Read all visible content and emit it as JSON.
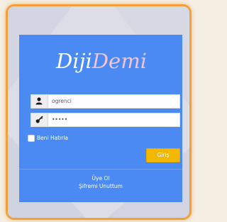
{
  "logo": {
    "part1": "Diji",
    "part2": "Demi"
  },
  "username": {
    "value": "ogrenci"
  },
  "password": {
    "value": "•••••"
  },
  "remember": {
    "label": "Beni Hatırla"
  },
  "login_button": {
    "label": "Giriş"
  },
  "links": {
    "signup": "Üye Ol",
    "forgot": "Şifremi Unuttum"
  },
  "colors": {
    "card": "#4a8af2",
    "button": "#f2b800",
    "frame_border": "#f2a13a",
    "logo_accent": "#f0c4d4"
  },
  "icons": {
    "user": "user-icon",
    "password": "key-icon"
  }
}
